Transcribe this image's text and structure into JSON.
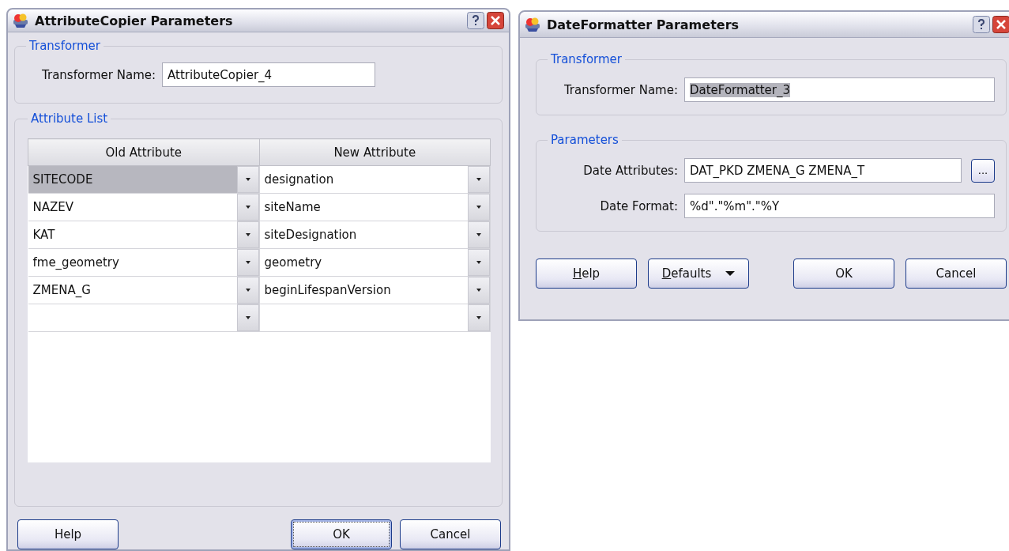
{
  "dialogs": [
    {
      "title": "AttributeCopier Parameters",
      "groups": [
        {
          "kind": "form",
          "title": "Transformer",
          "fields": [
            {
              "label": "Transformer Name:",
              "value": "AttributeCopier_4",
              "text_selected": false
            }
          ]
        },
        {
          "kind": "table",
          "title": "Attribute List",
          "table": {
            "columns": [
              "Old Attribute",
              "New Attribute"
            ],
            "rows": [
              {
                "old": "SITECODE",
                "new": "designation",
                "selected": true
              },
              {
                "old": "NAZEV",
                "new": "siteName",
                "selected": false
              },
              {
                "old": "KAT",
                "new": "siteDesignation",
                "selected": false
              },
              {
                "old": "fme_geometry",
                "new": "geometry",
                "selected": false
              },
              {
                "old": "ZMENA_G",
                "new": "beginLifespanVersion",
                "selected": false
              },
              {
                "selected": false
              }
            ]
          }
        }
      ],
      "buttons_left": [
        {
          "label": "Help",
          "default": false,
          "mnemonic_underlined": false,
          "dropdown": false
        }
      ],
      "buttons_right": [
        {
          "label": "OK",
          "default": true,
          "mnemonic_underlined": false,
          "dropdown": false
        },
        {
          "label": "Cancel",
          "default": false,
          "mnemonic_underlined": false,
          "dropdown": false
        }
      ]
    },
    {
      "title": "DateFormatter Parameters",
      "groups": [
        {
          "kind": "form",
          "title": "Transformer",
          "fields": [
            {
              "label": "Transformer Name:",
              "value": "DateFormatter_3",
              "text_selected": true
            }
          ]
        },
        {
          "kind": "form",
          "title": "Parameters",
          "fields": [
            {
              "label": "Date Attributes:",
              "value": "DAT_PKD ZMENA_G ZMENA_T",
              "text_selected": false,
              "browse_button": "..."
            },
            {
              "label": "Date Format:",
              "value": "%d\".\"%m\".\"%Y",
              "text_selected": false
            }
          ]
        }
      ],
      "buttons_left": [
        {
          "label": "Help",
          "default": false,
          "mnemonic_underlined": true,
          "dropdown": false
        },
        {
          "label": "Defaults",
          "default": false,
          "mnemonic_underlined": true,
          "dropdown": true
        }
      ],
      "buttons_right": [
        {
          "label": "OK",
          "default": false,
          "mnemonic_underlined": false,
          "dropdown": false
        },
        {
          "label": "Cancel",
          "default": false,
          "mnemonic_underlined": false,
          "dropdown": false
        }
      ]
    }
  ]
}
